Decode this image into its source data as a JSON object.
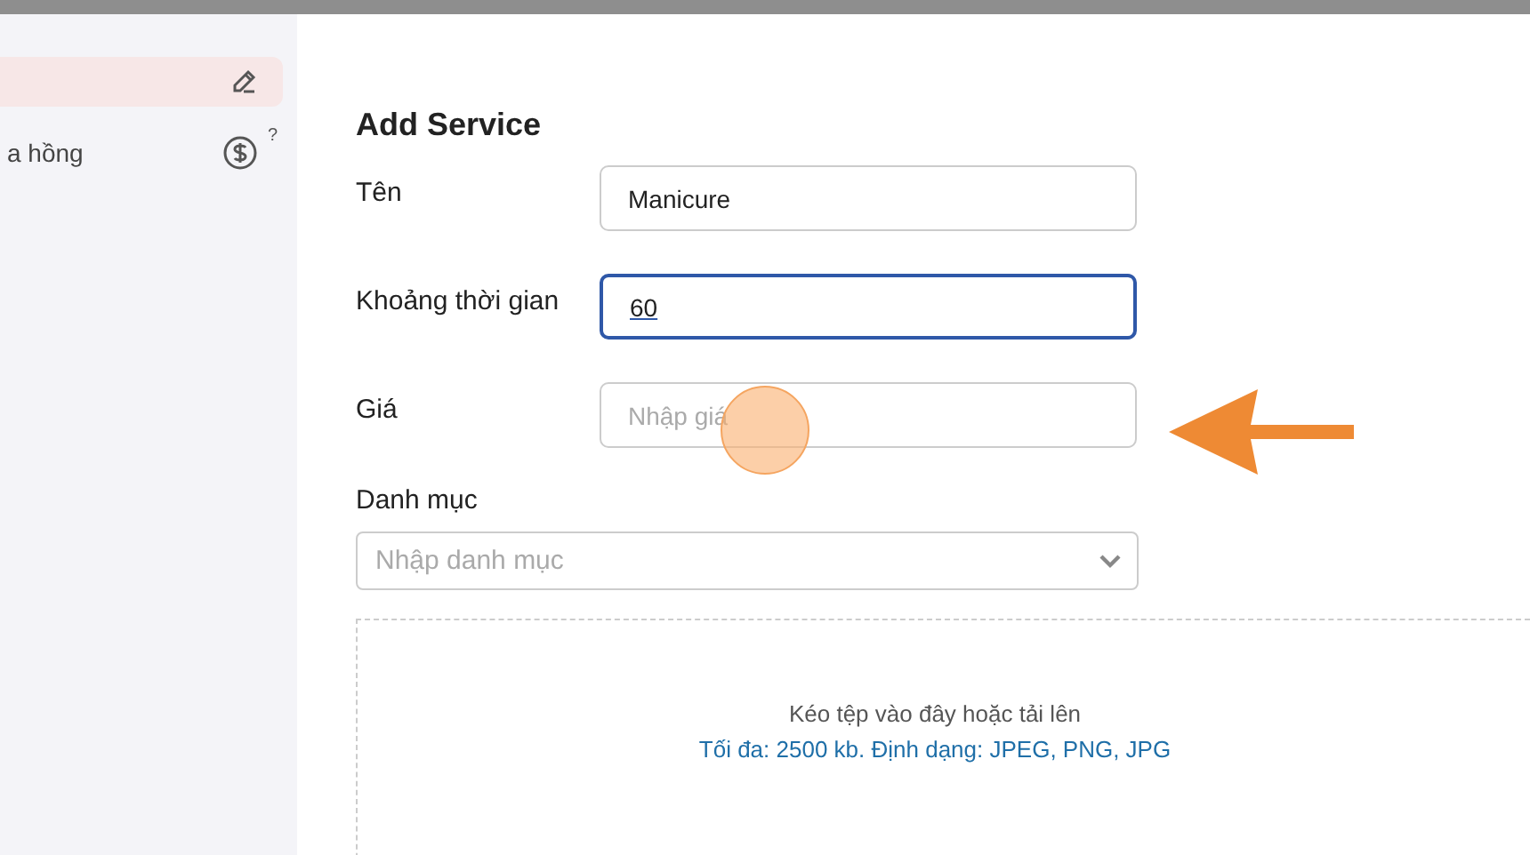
{
  "sidebar": {
    "items": [
      {
        "selected": true,
        "kind": "edit"
      },
      {
        "label": "a hồng",
        "selected": false,
        "kind": "commission",
        "badge": "?"
      }
    ]
  },
  "form": {
    "title": "Add Service",
    "fields": [
      {
        "label": "Tên",
        "value": "Manicure",
        "focused": false
      },
      {
        "label": "Khoảng thời gian",
        "value": "60",
        "focused": true
      },
      {
        "label": "Giá",
        "placeholder": "Nhập giá",
        "focused": false
      }
    ],
    "category": {
      "label": "Danh mục",
      "placeholder": "Nhập danh mục"
    },
    "upload": {
      "hint": "Kéo tệp vào đây hoặc tải lên",
      "limits": "Tối đa: 2500 kb. Định dạng: JPEG, PNG, JPG"
    }
  }
}
